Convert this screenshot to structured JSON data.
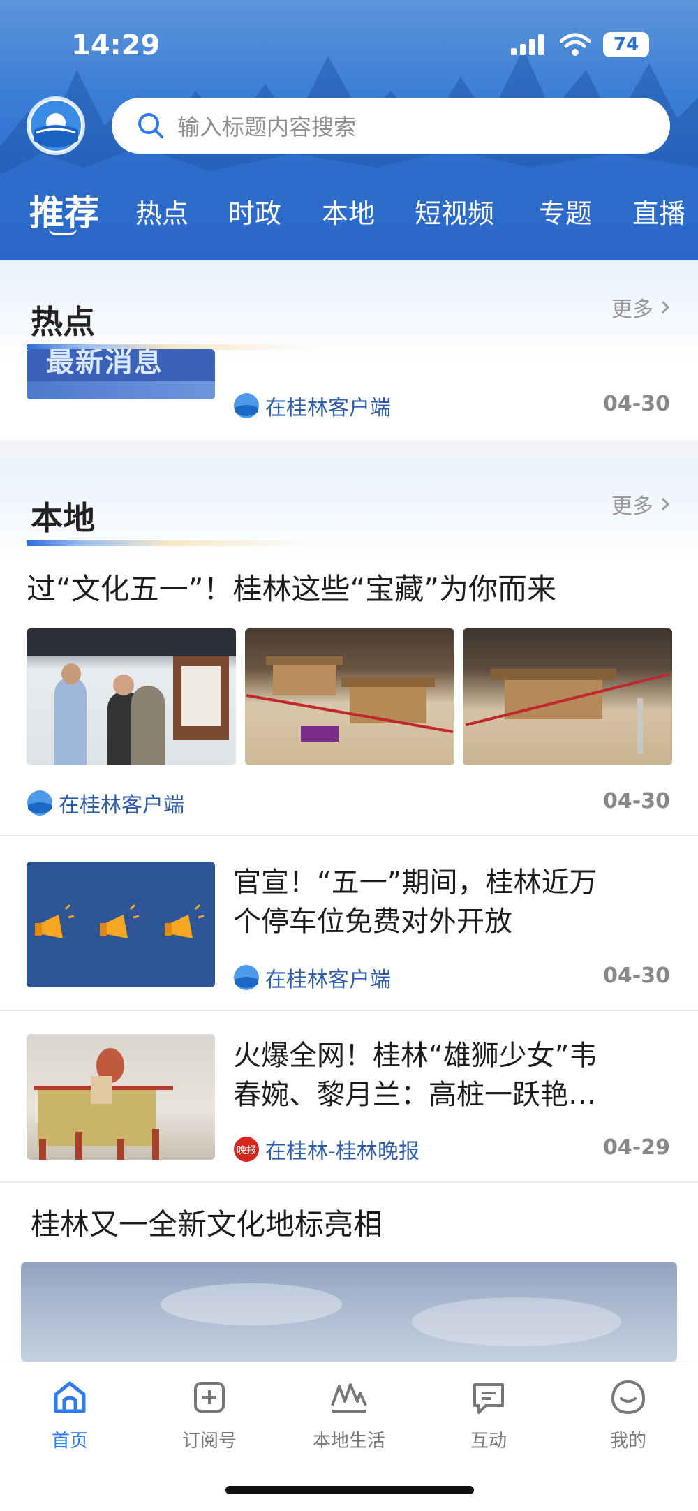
{
  "status_bar": {
    "time": "14:29",
    "battery": "74"
  },
  "search": {
    "placeholder": "输入标题内容搜索"
  },
  "tabs": [
    {
      "label": "推荐"
    },
    {
      "label": "热点"
    },
    {
      "label": "时政"
    },
    {
      "label": "本地"
    },
    {
      "label": "短视频"
    },
    {
      "label": "专题"
    },
    {
      "label": "直播"
    }
  ],
  "hot": {
    "title": "热点",
    "more": "更多",
    "item": {
      "thumb_text": "最新消息",
      "source": "在桂林客户端",
      "date": "04-30"
    }
  },
  "local": {
    "title": "本地",
    "more": "更多",
    "articles": [
      {
        "title": "过“文化五一”！桂林这些“宝藏”为你而来",
        "source": "在桂林客户端",
        "date": "04-30"
      },
      {
        "title_line1": "官宣！“五一”期间，桂林近万",
        "title_line2": "个停车位免费对外开放",
        "source": "在桂林客户端",
        "date": "04-30"
      },
      {
        "title_line1": "火爆全网！桂林“雄狮少女”韦",
        "title_line2": "春婉、黎月兰：高桩一跃艳…",
        "source": "在桂林-桂林晚报",
        "date": "04-29"
      },
      {
        "title": "桂林又一全新文化地标亮相"
      }
    ]
  },
  "bottom_nav": [
    {
      "label": "首页",
      "icon": "home-icon"
    },
    {
      "label": "订阅号",
      "icon": "subscribe-icon"
    },
    {
      "label": "本地生活",
      "icon": "local-life-icon"
    },
    {
      "label": "互动",
      "icon": "chat-icon"
    },
    {
      "label": "我的",
      "icon": "profile-icon"
    }
  ],
  "colors": {
    "accent": "#2e7bf0",
    "header": "#2e6fcf",
    "source_text": "#2f5ea8"
  }
}
